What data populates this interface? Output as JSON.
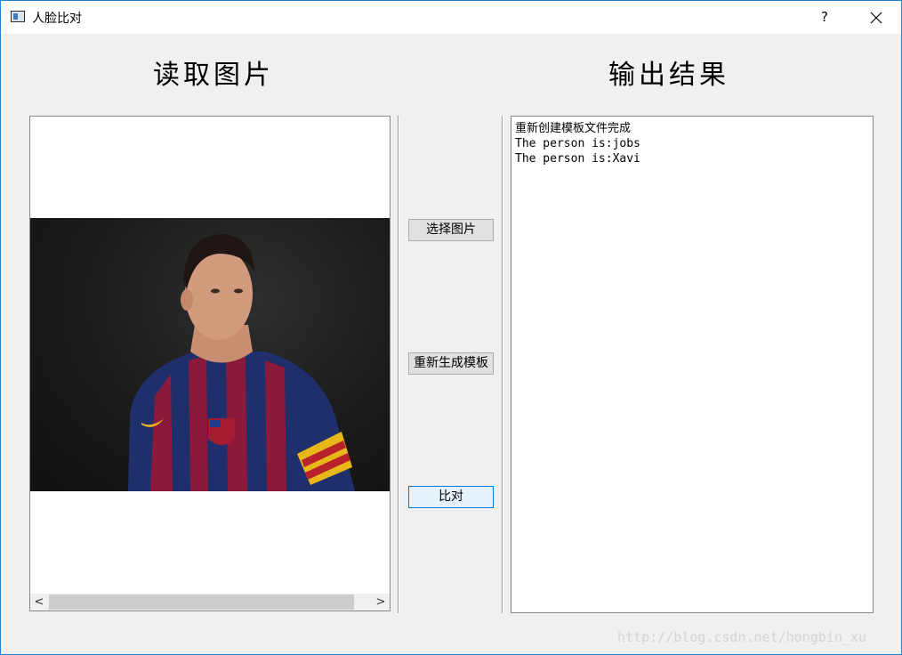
{
  "window": {
    "title": "人脸比对",
    "help_label": "?"
  },
  "headings": {
    "left": "读取图片",
    "right": "输出结果"
  },
  "buttons": {
    "select_image": "选择图片",
    "regenerate_template": "重新生成模板",
    "compare": "比对"
  },
  "output": {
    "lines": [
      "重新创建模板文件完成",
      "The person is:jobs",
      "The person is:Xavi"
    ]
  },
  "scrollbar": {
    "left_arrow": "<",
    "right_arrow": ">"
  },
  "watermark": "http://blog.csdn.net/hongbin_xu",
  "colors": {
    "window_border": "#1883d7",
    "focus_border": "#0078d7",
    "background": "#f0f0f0"
  }
}
